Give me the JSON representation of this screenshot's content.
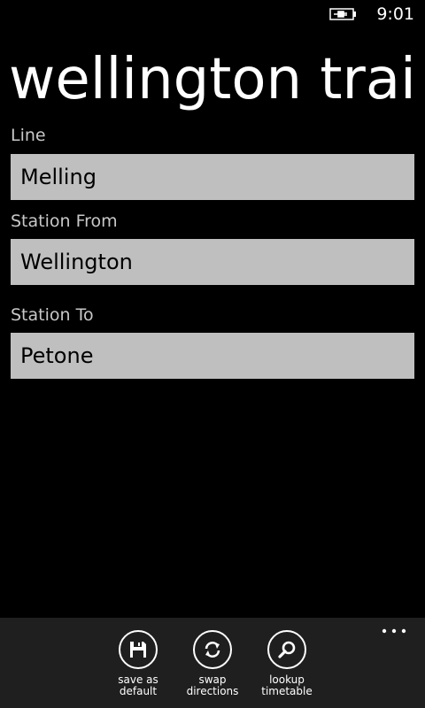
{
  "status_bar": {
    "time": "9:01",
    "battery_icon": "battery-charging-icon"
  },
  "page": {
    "title": "wellington train"
  },
  "form": {
    "line": {
      "label": "Line",
      "value": "Melling"
    },
    "station_from": {
      "label": "Station From",
      "value": "Wellington"
    },
    "station_to": {
      "label": "Station To",
      "value": "Petone"
    }
  },
  "app_bar": {
    "buttons": [
      {
        "label": "save as\ndefault",
        "icon": "save-icon"
      },
      {
        "label": "swap\ndirections",
        "icon": "refresh-icon"
      },
      {
        "label": "lookup\ntimetable",
        "icon": "search-icon"
      }
    ],
    "more_icon": "more-icon"
  },
  "colors": {
    "background": "#000000",
    "field_background": "#bfbfbf",
    "app_bar_background": "#1f1f1f",
    "label_text": "#c8c8c8"
  }
}
